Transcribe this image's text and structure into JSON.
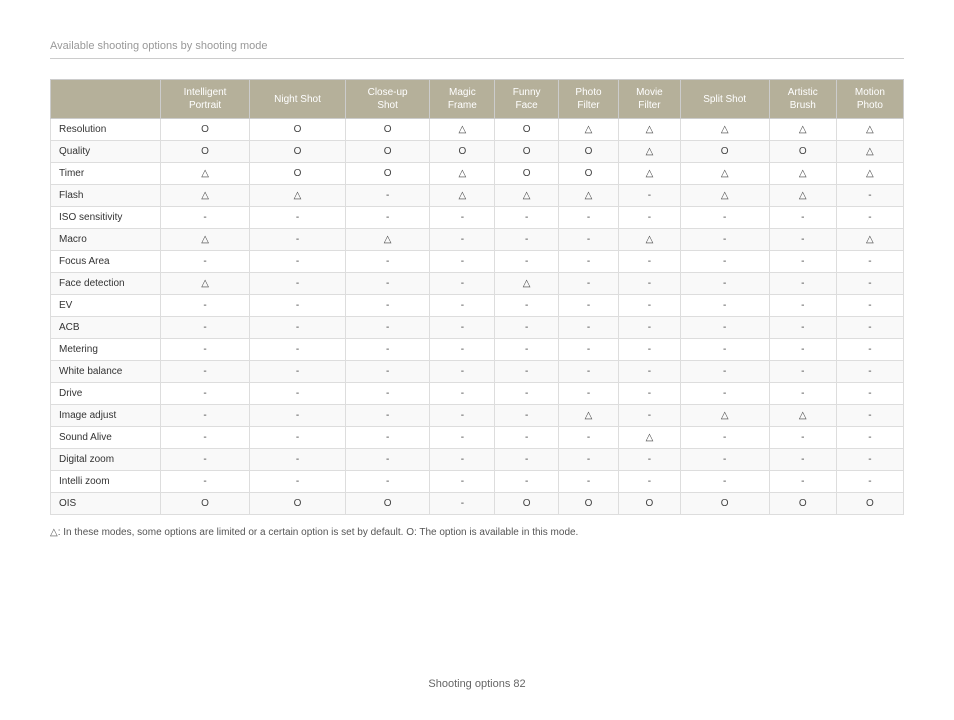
{
  "page": {
    "title": "Available shooting options by shooting mode",
    "footer": "Shooting options  82"
  },
  "table": {
    "headers": [
      "",
      "Intelligent Portrait",
      "Night Shot",
      "Close-up Shot",
      "Magic Frame",
      "Funny Face",
      "Photo Filter",
      "Movie Filter",
      "Split Shot",
      "Artistic Brush",
      "Motion Photo"
    ],
    "footnote": "△: In these modes, some options are limited or a certain option is set by default. O: The option is available in this mode.",
    "rows": [
      {
        "label": "Resolution",
        "cols": [
          "O",
          "O",
          "O",
          "△",
          "O",
          "△",
          "△",
          "△",
          "△",
          "△"
        ]
      },
      {
        "label": "Quality",
        "cols": [
          "O",
          "O",
          "O",
          "O",
          "O",
          "O",
          "△",
          "O",
          "O",
          "△"
        ]
      },
      {
        "label": "Timer",
        "cols": [
          "△",
          "O",
          "O",
          "△",
          "O",
          "O",
          "△",
          "△",
          "△",
          "△"
        ]
      },
      {
        "label": "Flash",
        "cols": [
          "△",
          "△",
          "-",
          "△",
          "△",
          "△",
          "-",
          "△",
          "△",
          "-"
        ]
      },
      {
        "label": "ISO sensitivity",
        "cols": [
          "-",
          "-",
          "-",
          "-",
          "-",
          "-",
          "-",
          "-",
          "-",
          "-"
        ]
      },
      {
        "label": "Macro",
        "cols": [
          "△",
          "-",
          "△",
          "-",
          "-",
          "-",
          "△",
          "-",
          "-",
          "△"
        ]
      },
      {
        "label": "Focus Area",
        "cols": [
          "-",
          "-",
          "-",
          "-",
          "-",
          "-",
          "-",
          "-",
          "-",
          "-"
        ]
      },
      {
        "label": "Face detection",
        "cols": [
          "△",
          "-",
          "-",
          "-",
          "△",
          "-",
          "-",
          "-",
          "-",
          "-"
        ]
      },
      {
        "label": "EV",
        "cols": [
          "-",
          "-",
          "-",
          "-",
          "-",
          "-",
          "-",
          "-",
          "-",
          "-"
        ]
      },
      {
        "label": "ACB",
        "cols": [
          "-",
          "-",
          "-",
          "-",
          "-",
          "-",
          "-",
          "-",
          "-",
          "-"
        ]
      },
      {
        "label": "Metering",
        "cols": [
          "-",
          "-",
          "-",
          "-",
          "-",
          "-",
          "-",
          "-",
          "-",
          "-"
        ]
      },
      {
        "label": "White balance",
        "cols": [
          "-",
          "-",
          "-",
          "-",
          "-",
          "-",
          "-",
          "-",
          "-",
          "-"
        ]
      },
      {
        "label": "Drive",
        "cols": [
          "-",
          "-",
          "-",
          "-",
          "-",
          "-",
          "-",
          "-",
          "-",
          "-"
        ]
      },
      {
        "label": "Image adjust",
        "cols": [
          "-",
          "-",
          "-",
          "-",
          "-",
          "△",
          "-",
          "△",
          "△",
          "-"
        ]
      },
      {
        "label": "Sound Alive",
        "cols": [
          "-",
          "-",
          "-",
          "-",
          "-",
          "-",
          "△",
          "-",
          "-",
          "-"
        ]
      },
      {
        "label": "Digital zoom",
        "cols": [
          "-",
          "-",
          "-",
          "-",
          "-",
          "-",
          "-",
          "-",
          "-",
          "-"
        ]
      },
      {
        "label": "Intelli zoom",
        "cols": [
          "-",
          "-",
          "-",
          "-",
          "-",
          "-",
          "-",
          "-",
          "-",
          "-"
        ]
      },
      {
        "label": "OIS",
        "cols": [
          "O",
          "O",
          "O",
          "-",
          "O",
          "O",
          "O",
          "O",
          "O",
          "O"
        ]
      }
    ]
  }
}
